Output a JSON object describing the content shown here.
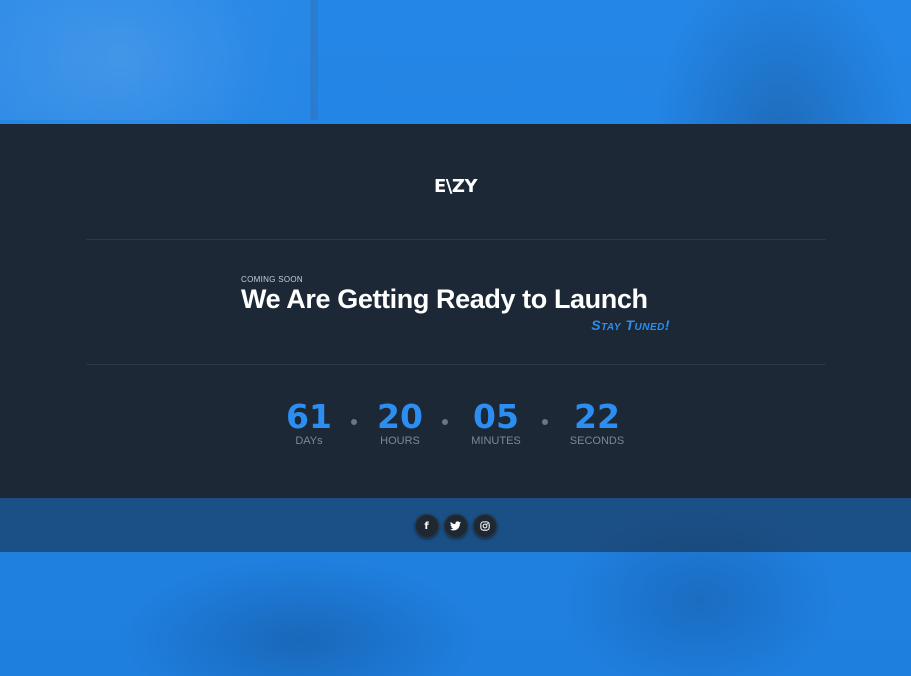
{
  "brand": {
    "logo_text": "E\\ZY"
  },
  "hero": {
    "eyebrow": "COMING SOON",
    "headline": "We Are Getting Ready to Launch",
    "tagline": "Stay Tuned!"
  },
  "countdown": [
    {
      "value": "61",
      "label": "DAYs"
    },
    {
      "value": "20",
      "label": "HOURS"
    },
    {
      "value": "05",
      "label": "MINUTES"
    },
    {
      "value": "22",
      "label": "SECONDS"
    }
  ],
  "social": [
    {
      "icon": "facebook-icon",
      "glyph": "f"
    },
    {
      "icon": "twitter-icon",
      "glyph": "🐦"
    },
    {
      "icon": "instagram-icon",
      "glyph": "◎"
    }
  ],
  "colors": {
    "accent": "#2b8ef0",
    "dark_panel": "#1c2835",
    "background_blue": "#2383e2"
  }
}
